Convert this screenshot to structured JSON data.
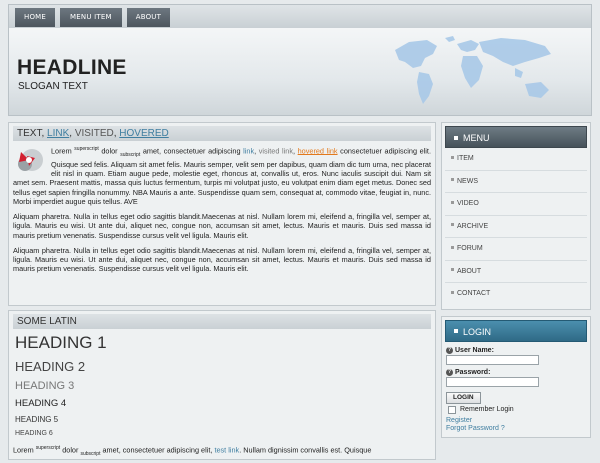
{
  "nav": {
    "items": [
      "HOME",
      "MENU ITEM",
      "ABOUT"
    ]
  },
  "header": {
    "headline": "HEADLINE",
    "slogan": "SLOGAN TEXT"
  },
  "panel1": {
    "title": {
      "text": "TEXT, ",
      "link": "LINK",
      "sep": ", ",
      "visited": "VISITED",
      "sep2": ", ",
      "hovered": "HOVERED"
    },
    "para1": {
      "a": "Lorem ",
      "sup": "superscript",
      "b": " dolor ",
      "sub": "subscript",
      "c": " amet, consectetuer adipiscing ",
      "link": "link",
      "d": ", ",
      "visited": "visited link",
      "e": ", ",
      "hovered": "hovered link",
      "f": " consectetuer adipiscing elit. Quisque sed felis. Aliquam sit amet felis. Mauris semper, velit sem per dapibus, quam diam dic tum urna, nec placerat elit nisl in quam. Etiam augue pede, molestie eget, rhoncus at, convallis ut, eros. Nunc iaculis suscipit dui. Nam sit amet sem. Praesent mattis, massa quis luctus fermentum, turpis mi volutpat justo, eu volutpat enim diam eget metus. Donec sed tellus eget sapien fringilla nonummy. NBA Mauris a ante. Suspendisse quam sem, consequat at, commodo vitae, feugiat in, nunc. Morbi imperdiet augue quis tellus. AVE"
    },
    "para2": "Aliquam pharetra. Nulla in tellus eget odio sagittis blandit.Maecenas at nisl. Nullam lorem mi, eleifend a, fringilla vel, semper at, ligula. Mauris eu wisi. Ut ante dui, aliquet nec, congue non, accumsan sit amet, lectus. Mauris et mauris. Duis sed massa id mauris pretium venenatis. Suspendisse cursus velit vel ligula. Mauris elit.",
    "para3": "Aliquam pharetra. Nulla in tellus eget odio sagittis blandit.Maecenas at nisl. Nullam lorem mi, eleifend a, fringilla vel, semper at, ligula. Mauris eu wisi. Ut ante dui, aliquet nec, congue non, accumsan sit amet, lectus. Mauris et mauris. Duis sed massa id mauris pretium venenatis. Suspendisse cursus velit vel ligula. Mauris elit."
  },
  "panel2": {
    "title": "SOME LATIN",
    "h1": "HEADING 1",
    "h2": "HEADING 2",
    "h3": "HEADING 3",
    "h4": "HEADING 4",
    "h5": "HEADING 5",
    "h6": "HEADING 6",
    "para": {
      "a": "Lorem ",
      "sup": "superscript",
      "b": " dolor ",
      "sub": "subscript",
      "c": " amet, consectetuer adipiscing elit, ",
      "link": "test link",
      "d": ". Nullam dignissim convallis est. Quisque"
    }
  },
  "menu": {
    "title": "MENU",
    "items": [
      "ITEM",
      "NEWS",
      "VIDEO",
      "ARCHIVE",
      "FORUM",
      "ABOUT",
      "CONTACT"
    ]
  },
  "login": {
    "title": "LOGIN",
    "username_label": "User Name:",
    "password_label": "Password:",
    "button": "LOGIN",
    "remember": "Remember Login",
    "register": "Register",
    "forgot": "Forgot Password ?"
  },
  "colors": {
    "accent": "#3f7ea0",
    "hover": "#e2791d",
    "login_header": "#2f6a86",
    "menu_header": "#46525a"
  },
  "icons": [
    "question-icon",
    "world-map",
    "globe-badge-icon"
  ]
}
